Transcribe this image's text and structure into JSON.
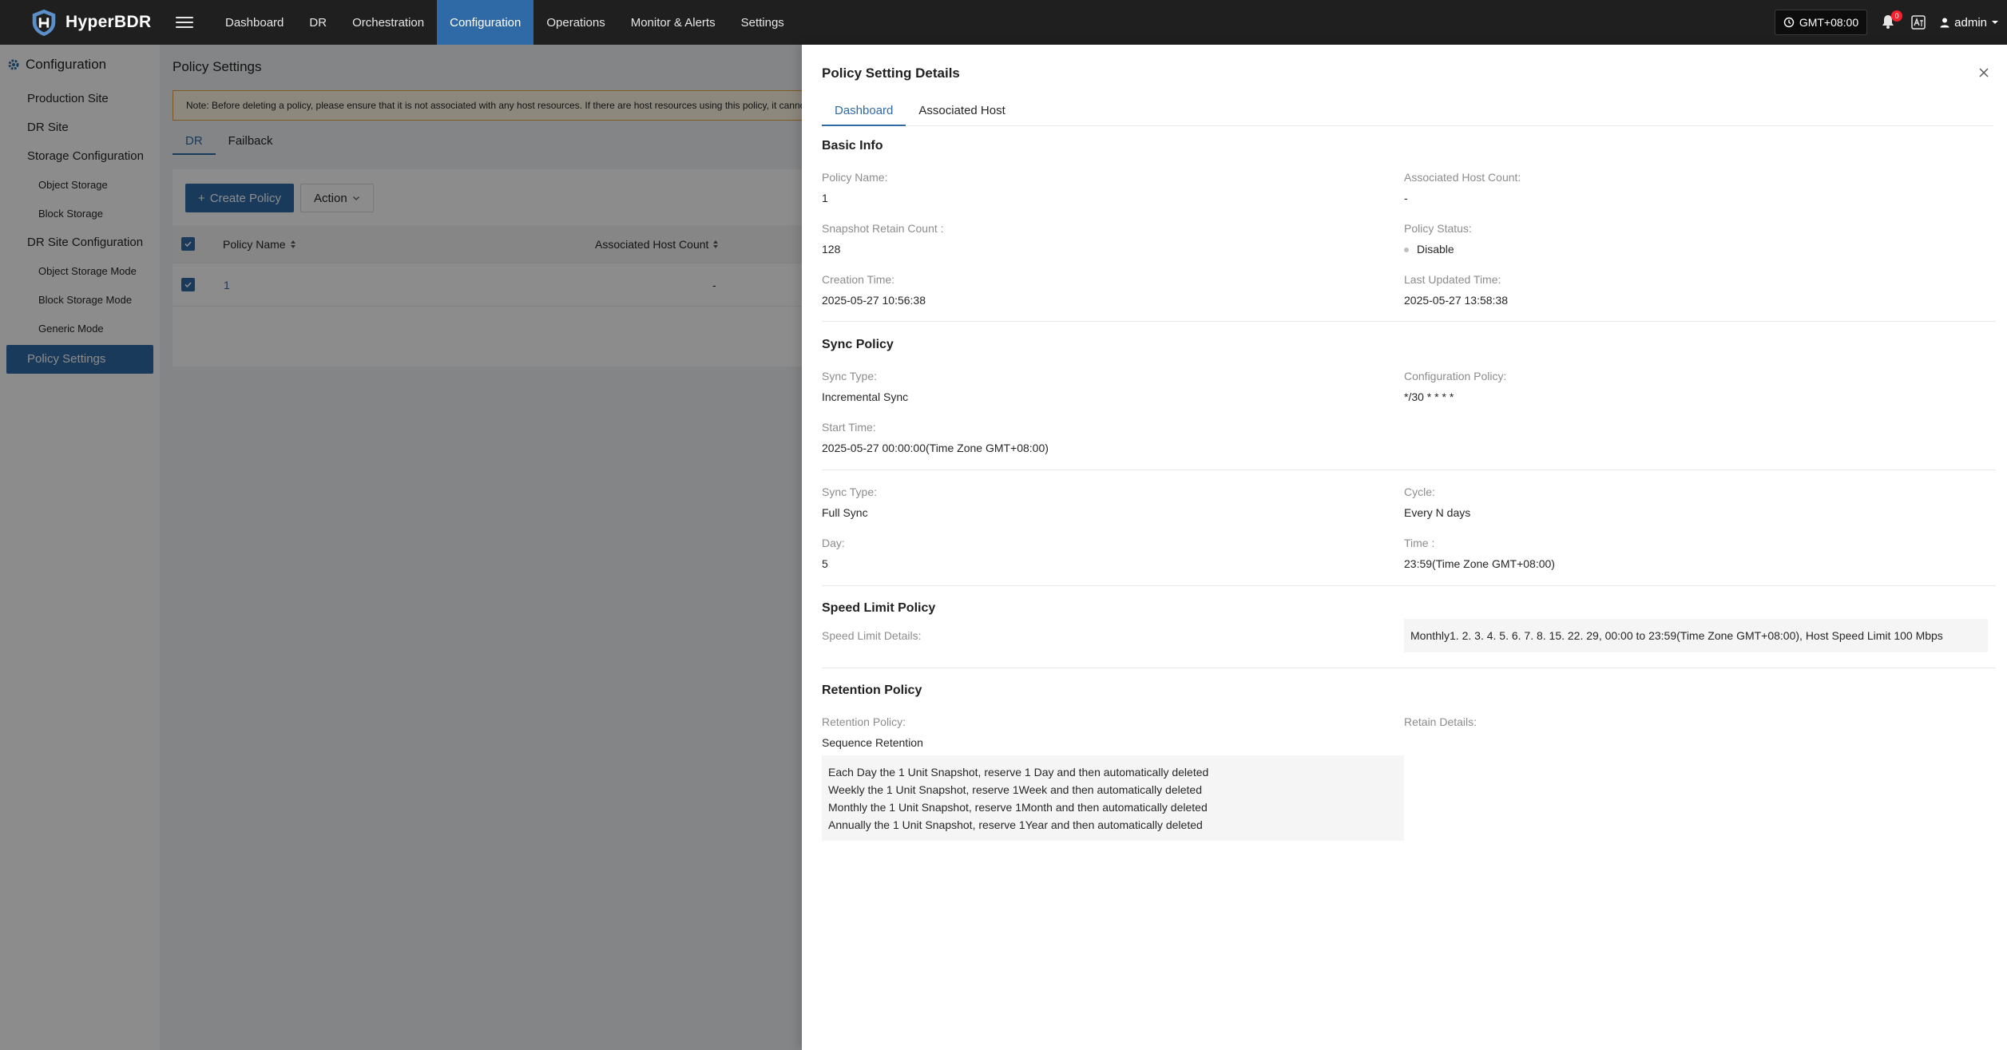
{
  "brand": {
    "name": "HyperBDR",
    "logo_icon": "shield-logo-icon"
  },
  "nav": {
    "items": [
      {
        "label": "Dashboard"
      },
      {
        "label": "DR"
      },
      {
        "label": "Orchestration"
      },
      {
        "label": "Configuration",
        "active": true
      },
      {
        "label": "Operations"
      },
      {
        "label": "Monitor & Alerts"
      },
      {
        "label": "Settings"
      }
    ]
  },
  "topbar": {
    "timezone": "GMT+08:00",
    "notification_count": "0",
    "user": "admin"
  },
  "sidebar": {
    "heading": "Configuration",
    "items": [
      {
        "label": "Production Site"
      },
      {
        "label": "DR Site"
      },
      {
        "label": "Storage Configuration"
      },
      {
        "label": "Object Storage"
      },
      {
        "label": "Block Storage"
      },
      {
        "label": "DR Site Configuration"
      },
      {
        "label": "Object Storage Mode"
      },
      {
        "label": "Block Storage Mode"
      },
      {
        "label": "Generic Mode"
      },
      {
        "label": "Policy Settings"
      }
    ]
  },
  "page": {
    "title": "Policy Settings",
    "notice": "Note: Before deleting a policy, please ensure that it is not associated with any host resources. If there are host resources using this policy, it cannot",
    "tabs": [
      {
        "label": "DR"
      },
      {
        "label": "Failback"
      }
    ],
    "create_button": "Create Policy",
    "action_button": "Action",
    "table": {
      "columns": [
        "Policy Name",
        "Associated Host Count"
      ],
      "rows": [
        {
          "name": "1",
          "host_count": "-"
        }
      ]
    }
  },
  "drawer": {
    "title": "Policy Setting Details",
    "tabs": [
      {
        "label": "Dashboard"
      },
      {
        "label": "Associated Host"
      }
    ],
    "basic_info": {
      "title": "Basic Info",
      "policy_name_label": "Policy Name:",
      "policy_name": "1",
      "host_count_label": "Associated Host Count:",
      "host_count": "-",
      "snapshot_label": "Snapshot Retain Count :",
      "snapshot": "128",
      "status_label": "Policy Status:",
      "status": "Disable",
      "creation_label": "Creation Time:",
      "creation": "2025-05-27 10:56:38",
      "updated_label": "Last Updated Time:",
      "updated": "2025-05-27 13:58:38"
    },
    "sync_policy": {
      "title": "Sync Policy",
      "inc_type_label": "Sync Type:",
      "inc_type": "Incremental Sync",
      "config_label": "Configuration Policy:",
      "config": "*/30 * * * *",
      "start_label": "Start Time:",
      "start": "2025-05-27 00:00:00(Time Zone GMT+08:00)",
      "full_type_label": "Sync Type:",
      "full_type": "Full Sync",
      "cycle_label": "Cycle:",
      "cycle": "Every N days",
      "day_label": "Day:",
      "day": "5",
      "time_label": "Time :",
      "time": "23:59(Time Zone GMT+08:00)"
    },
    "speed_limit": {
      "title": "Speed Limit Policy",
      "label": "Speed Limit Details:",
      "value": "Monthly1. 2. 3. 4. 5. 6. 7. 8. 15. 22. 29, 00:00 to 23:59(Time Zone GMT+08:00), Host Speed Limit 100 Mbps"
    },
    "retention": {
      "title": "Retention Policy",
      "policy_label": "Retention Policy:",
      "policy": "Sequence Retention",
      "details_label": "Retain Details:",
      "lines": [
        "Each Day the 1 Unit Snapshot, reserve 1 Day and then automatically deleted",
        "Weekly the 1 Unit Snapshot, reserve 1Week and then automatically deleted",
        "Monthly the 1 Unit Snapshot, reserve 1Month and then automatically deleted",
        "Annually the 1 Unit Snapshot, reserve 1Year and then automatically deleted"
      ]
    }
  },
  "colors": {
    "accent": "#2f6aa6",
    "topbar": "#1f1f1f",
    "notice_border": "#e8a33c"
  }
}
